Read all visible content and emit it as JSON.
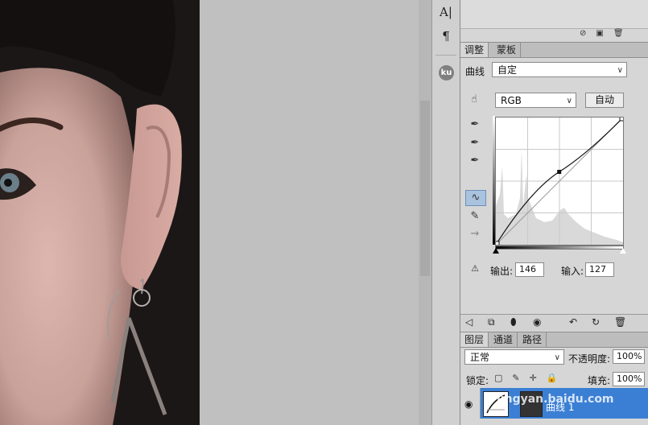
{
  "tool_strip": {
    "text_tool_glyph": "A|",
    "paragraph_glyph": "¶",
    "ku_badge": "ku"
  },
  "adjust_panel": {
    "tabs": [
      {
        "label": "调整",
        "active": true
      },
      {
        "label": "蒙板",
        "active": false
      }
    ],
    "curves_label": "曲线",
    "preset_value": "自定",
    "channel_value": "RGB",
    "auto_button": "自动",
    "output_label": "输出:",
    "output_value": "146",
    "input_label": "输入:",
    "input_value": "127"
  },
  "curve": {
    "control_point": {
      "input": 127,
      "output": 146
    },
    "range": [
      0,
      255
    ]
  },
  "layers_panel": {
    "tabs": [
      {
        "label": "图层",
        "active": true
      },
      {
        "label": "通道",
        "active": false
      },
      {
        "label": "路径",
        "active": false
      }
    ],
    "blend_mode": "正常",
    "opacity_label": "不透明度:",
    "opacity_value": "100%",
    "lock_label": "锁定:",
    "fill_label": "填充:",
    "fill_value": "100%",
    "layer_name": "曲线 1"
  },
  "watermark": "jingyan.baidu.com",
  "colors": {
    "selection_blue": "#3b7fd4",
    "panel_gray": "#d6d6d6"
  }
}
